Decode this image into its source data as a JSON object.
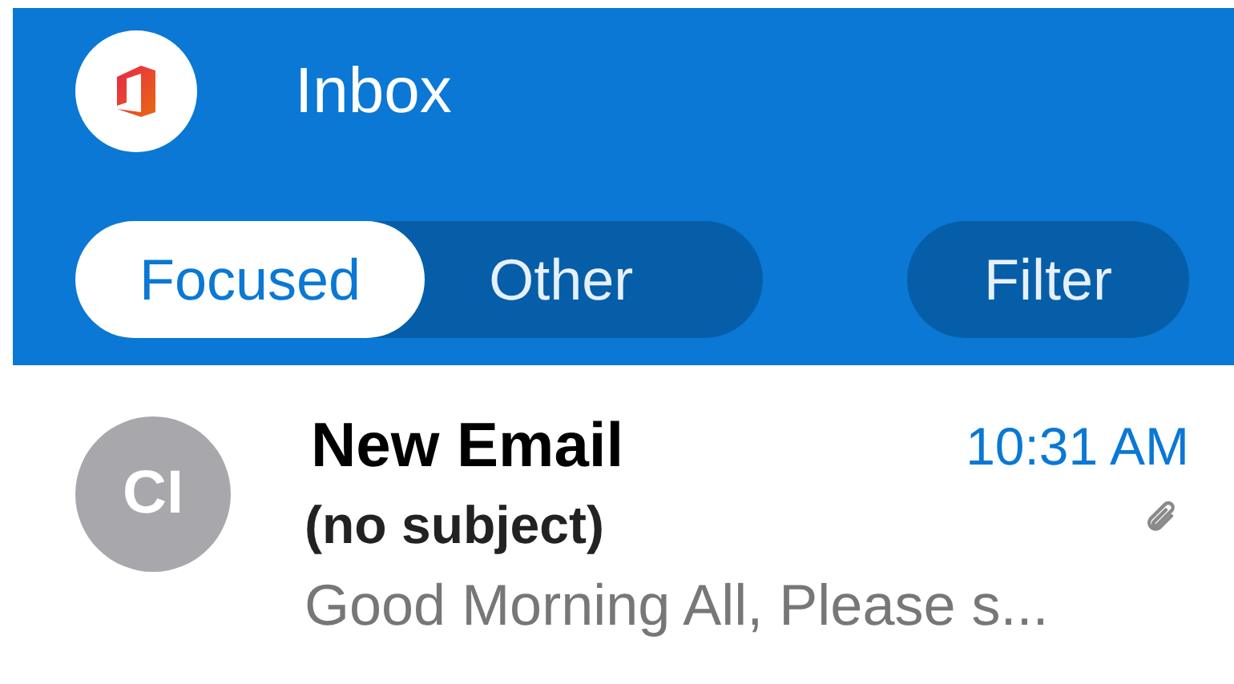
{
  "header": {
    "title": "Inbox"
  },
  "tabs": [
    {
      "label": "Focused",
      "selected": true
    },
    {
      "label": "Other",
      "selected": false
    }
  ],
  "filter_button": {
    "label": "Filter"
  },
  "messages": [
    {
      "initials": "CI",
      "sender": "New Email",
      "time": "10:31 AM",
      "subject": "(no subject)",
      "has_attachment": true,
      "preview": "Good Morning All, Please s..."
    }
  ]
}
